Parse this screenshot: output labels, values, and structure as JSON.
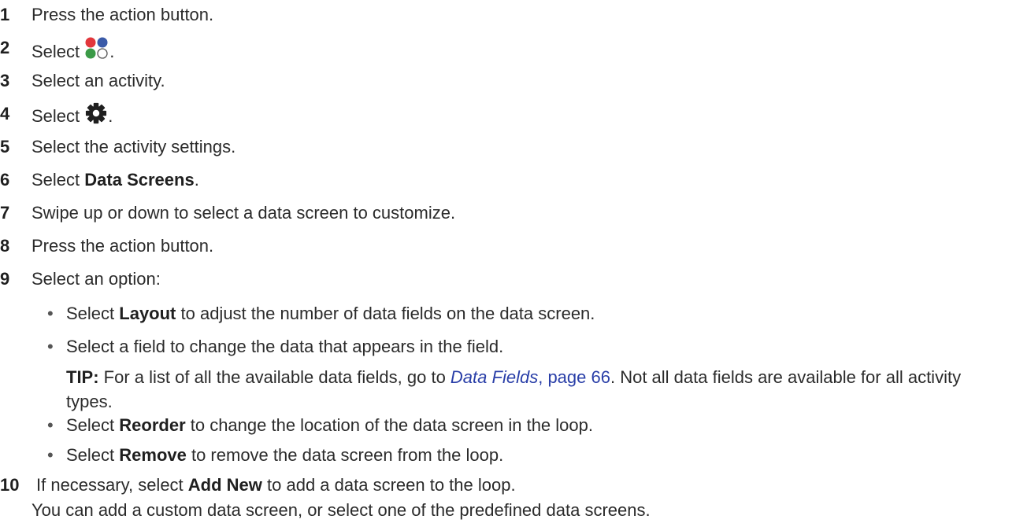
{
  "steps": [
    {
      "num": "1",
      "text": "Press the action button."
    },
    {
      "num": "2",
      "pre": "Select ",
      "post": "."
    },
    {
      "num": "3",
      "text": "Select an activity."
    },
    {
      "num": "4",
      "pre": "Select ",
      "post": "."
    },
    {
      "num": "5",
      "text": "Select the activity settings."
    },
    {
      "num": "6",
      "pre": "Select ",
      "bold": "Data Screens",
      "post": "."
    },
    {
      "num": "7",
      "text": "Swipe up or down to select a data screen to customize."
    },
    {
      "num": "8",
      "text": "Press the action button."
    },
    {
      "num": "9",
      "text": "Select an option:"
    },
    {
      "num": "10",
      "pre": "If necessary, select ",
      "bold": "Add New",
      "post": " to add a data screen to the loop."
    }
  ],
  "bullets": [
    {
      "pre": "Select ",
      "bold": "Layout",
      "post": " to adjust the number of data fields on the data screen."
    },
    {
      "text": "Select a field to change the data that appears in the field."
    },
    {
      "pre": "Select ",
      "bold": "Reorder",
      "post": " to change the location of the data screen in the loop."
    },
    {
      "pre": "Select ",
      "bold": "Remove",
      "post": " to remove the data screen from the loop."
    }
  ],
  "tip": {
    "label": "TIP:",
    "pre": " For a list of all the available data fields, go to ",
    "link": "Data Fields",
    "mid": ", ",
    "page": "page 66",
    "post": ". Not all data fields are available for all activity types."
  },
  "note": "You can add a custom data screen, or select one of the predefined data screens.",
  "icons": {
    "apps": {
      "name": "activities-apps-icon",
      "colors": [
        "#e2363b",
        "#3a5aa8",
        "#3b9a47",
        "#ffffff"
      ]
    },
    "settings": {
      "name": "gear-icon",
      "color": "#1f1f1f"
    }
  }
}
